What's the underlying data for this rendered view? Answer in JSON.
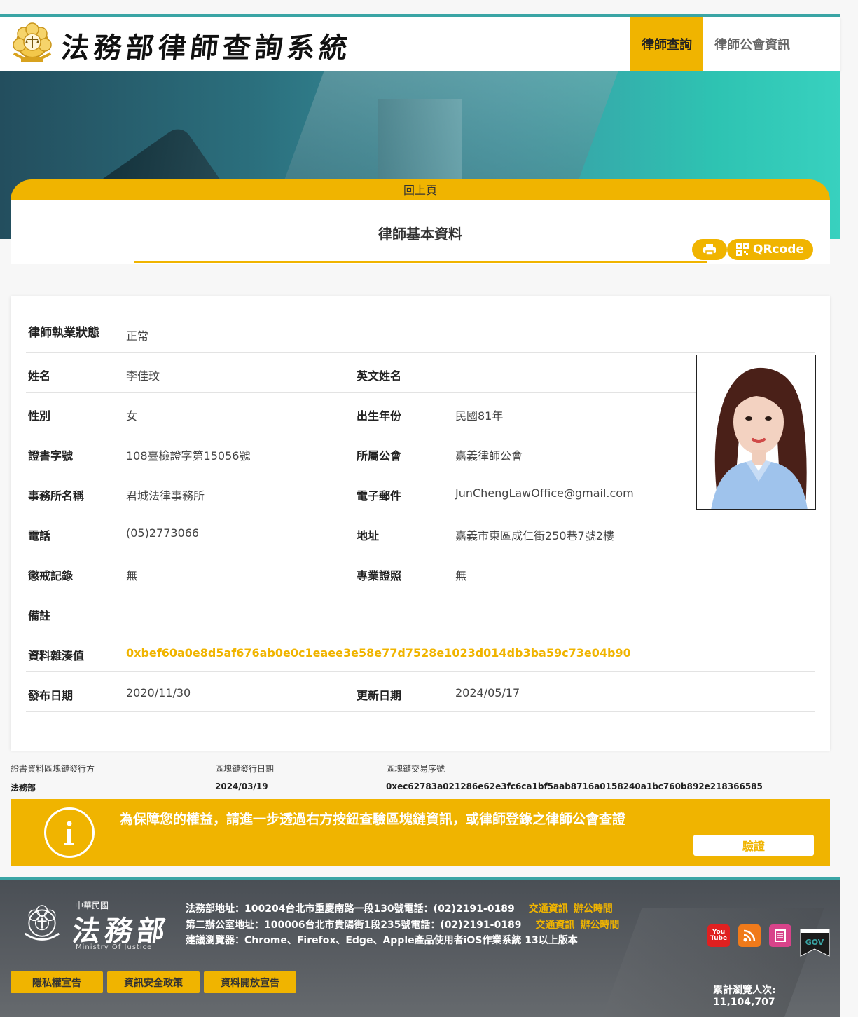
{
  "header": {
    "site_title": "法務部律師查詢系統",
    "nav": [
      "律師查詢",
      "律師公會資訊"
    ]
  },
  "back_label": "回上頁",
  "page_title": "律師基本資料",
  "qr_label": "QRcode",
  "profile": {
    "status_label": "律師執業狀態",
    "status": "正常",
    "name_label": "姓名",
    "name": "李佳玟",
    "en_name_label": "英文姓名",
    "en_name": "",
    "gender_label": "性別",
    "gender": "女",
    "birth_label": "出生年份",
    "birth": "民國81年",
    "cert_label": "證書字號",
    "cert": "108臺檢證字第15056號",
    "bar_label": "所屬公會",
    "bar": "嘉義律師公會",
    "office_label": "事務所名稱",
    "office": "君城法律事務所",
    "email_label": "電子郵件",
    "email": "JunChengLawOffice@gmail.com",
    "phone_label": "電話",
    "phone": "(05)2773066",
    "address_label": "地址",
    "address": "嘉義市東區成仁街250巷7號2樓",
    "discipline_label": "懲戒記錄",
    "discipline": "無",
    "license_label": "專業證照",
    "license": "無",
    "note_label": "備註",
    "note": "",
    "hash_label": "資料雜湊值",
    "hash": "0xbef60a0e8d5af676ab0e0c1eaee3e58e77d7528e1023d014db3ba59c73e04b90",
    "publish_label": "發布日期",
    "publish": "2020/11/30",
    "update_label": "更新日期",
    "update": "2024/05/17"
  },
  "chain": {
    "issuer_label": "證書資料區塊鏈發行方",
    "issuer": "法務部",
    "date_label": "區塊鏈發行日期",
    "date": "2024/03/19",
    "tx_label": "區塊鏈交易序號",
    "tx": "0xec62783a021286e62e3fc6ca1bf5aab8716a0158240a1bc760b892e218366585"
  },
  "verify": {
    "message": "為保障您的權益，請進一步透過右方按鈕查驗區塊鏈資訊，或律師登錄之律師公會查證",
    "button": "驗證"
  },
  "footer": {
    "roc": "中華民國",
    "moj": "法務部",
    "moj_en": "Ministry Of Justice",
    "line1": "法務部地址：100204台北市重慶南路一段130號電話：(02)2191-0189",
    "line2": "第二辦公室地址：100006台北市貴陽街1段235號電話：(02)2191-0189",
    "line3": "建議瀏覽器：Chrome、Firefox、Edge、Apple產品使用者iOS作業系統 13以上版本",
    "traffic": "交通資訊",
    "hours": "辦公時間",
    "buttons": [
      "隱私權宣告",
      "資訊安全政策",
      "資料開放宣告"
    ],
    "visits": "累計瀏覽人次: 11,104,707",
    "youtube": "You Tube",
    "gov": "GOV"
  },
  "colors": {
    "accent": "#f0b400",
    "teal": "#3aa5a5",
    "footer": "#55595e"
  },
  "icons": [
    "moj-emblem-icon",
    "print-icon",
    "qrcode-icon",
    "info-icon",
    "youtube-icon",
    "rss-icon",
    "newsletter-icon",
    "gov-icon"
  ]
}
